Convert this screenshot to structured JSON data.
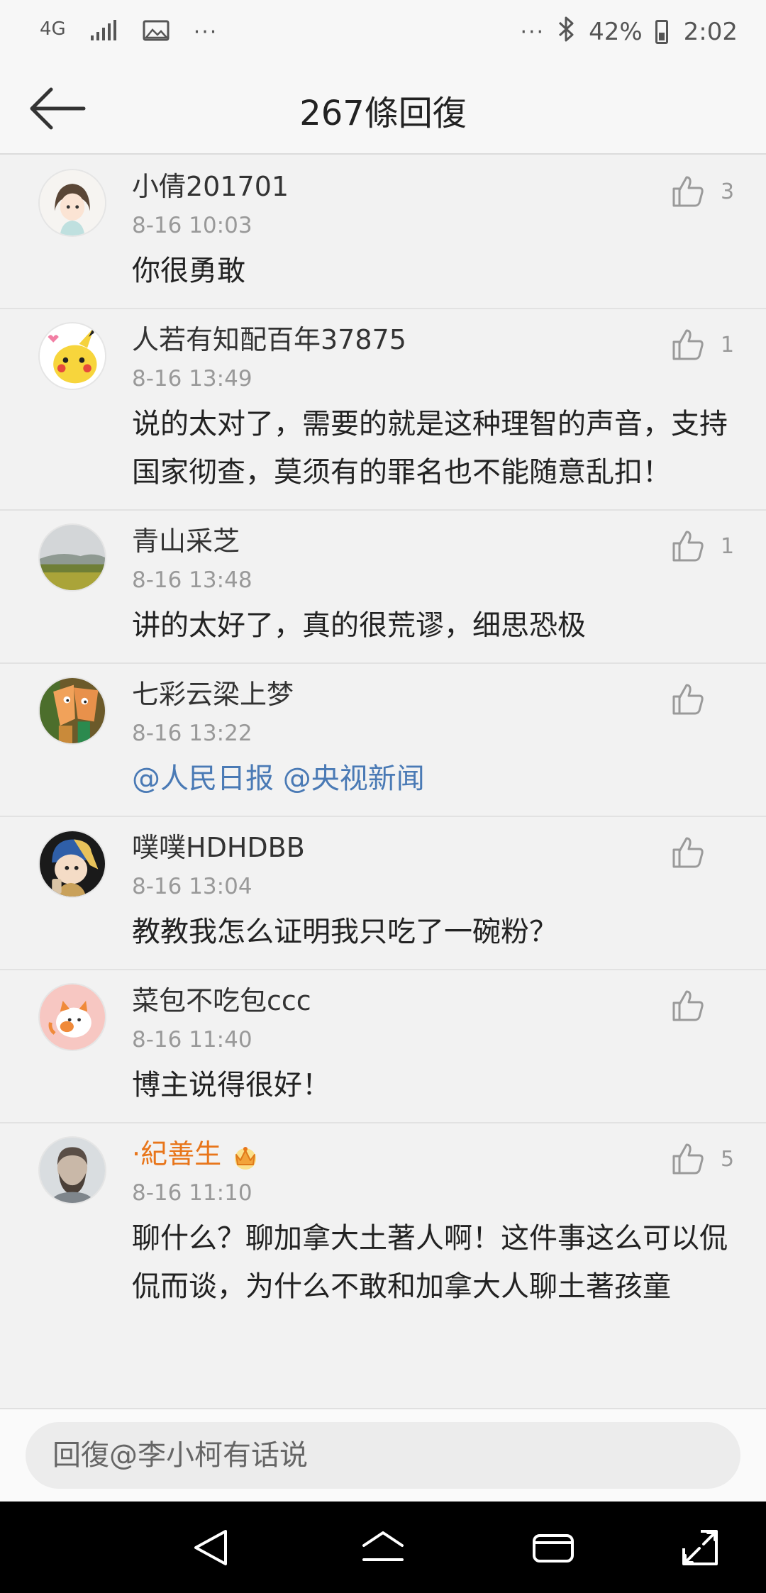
{
  "status_bar": {
    "network": "4G",
    "more_left": "···",
    "more_right": "···",
    "battery": "42%",
    "time": "2:02"
  },
  "header": {
    "title": "267條回復"
  },
  "comments": [
    {
      "name": "小倩201701",
      "time": "8-16 10:03",
      "text": "你很勇敢",
      "likes": "3"
    },
    {
      "name": "人若有知配百年37875",
      "time": "8-16 13:49",
      "text": "说的太对了，需要的就是这种理智的声音，支持国家彻查，莫须有的罪名也不能随意乱扣！",
      "likes": "1"
    },
    {
      "name": "青山采芝",
      "time": "8-16 13:48",
      "text": "讲的太好了，真的很荒谬，细思恐极",
      "likes": "1"
    },
    {
      "name": "七彩云梁上梦",
      "time": "8-16 13:22",
      "text": "@人民日报 @央视新闻",
      "likes": ""
    },
    {
      "name": "噗噗HDHDBB",
      "time": "8-16 13:04",
      "text": "教教我怎么证明我只吃了一碗粉？",
      "likes": ""
    },
    {
      "name": "菜包不吃包ccc",
      "time": "8-16 11:40",
      "text": "博主说得很好！",
      "likes": ""
    },
    {
      "name": "·紀善生",
      "time": "8-16 11:10",
      "text": "聊什么？聊加拿大土著人啊！这件事这么可以侃侃而谈，为什么不敢和加拿大人聊土著孩童",
      "likes": "5"
    }
  ],
  "reply": {
    "placeholder": "回復@李小柯有话说"
  },
  "colors": {
    "link": "#4a7ab5",
    "vip_name": "#e8751a",
    "secondary_text": "#999999"
  },
  "icons": [
    "signal-icon",
    "image-icon",
    "bluetooth-icon",
    "battery-icon",
    "back-arrow-icon",
    "thumbs-up-icon",
    "crown-icon",
    "nav-back-icon",
    "nav-home-icon",
    "nav-recents-icon",
    "nav-screen-icon"
  ]
}
